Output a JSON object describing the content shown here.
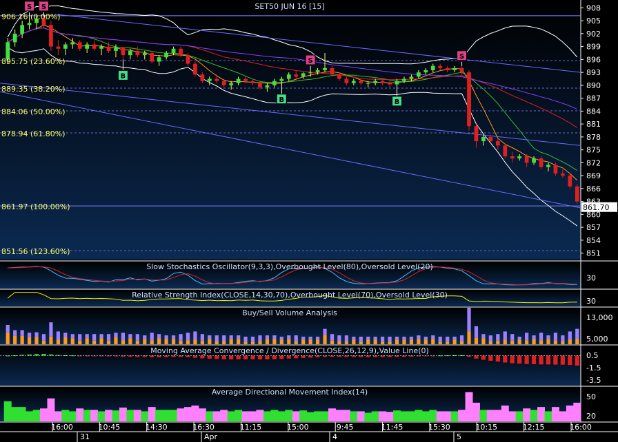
{
  "chart_data": {
    "type": "candlestick-multipanel",
    "title": "SET50 JUN 16   [15]",
    "colors": {
      "background_top": "#000000",
      "background_bottom": "#0b2a52",
      "panel_bg": "#0a2246",
      "axis_text": "#ffffff",
      "fib_text": "#ffff66",
      "title_text": "#cfe0ff",
      "candle_up": "#40e040",
      "candle_down": "#e02020",
      "bollinger": "#ffffff",
      "trendline": "#6a6aff",
      "ma_red": "#e02020",
      "ma_green": "#30c030",
      "ma_orange": "#ff9a20",
      "ma_purple": "#8040ff",
      "sell_marker": "#e0408a",
      "buy_marker": "#40e090",
      "stoch_k": "#40c0ff",
      "stoch_d": "#e02020",
      "rsi_line": "#f0f000",
      "vol_buy": "#ff9a20",
      "vol_sell": "#a080ff",
      "macd_pos": "#30e030",
      "macd_neg": "#e02020",
      "adx_plus": "#30e030",
      "adx_minus": "#ff80ff"
    },
    "price_axis": {
      "min": 849.5,
      "max": 909.5,
      "ticks": [
        908,
        905,
        902,
        899,
        896,
        893,
        890,
        887,
        884,
        881,
        878,
        875,
        872,
        869,
        866,
        863,
        860,
        857,
        854,
        851
      ],
      "last_price": "861.70"
    },
    "fib_levels": [
      {
        "label": "906.16 (0.00%)",
        "value": 906.16
      },
      {
        "label": "895.75 (23.60%)",
        "value": 895.75
      },
      {
        "label": "889.35 (38.20%)",
        "value": 889.35
      },
      {
        "label": "884.06 (50.00%)",
        "value": 884.06
      },
      {
        "label": "878.94 (61.80%)",
        "value": 878.94
      },
      {
        "label": "861.97 (100.00%)",
        "value": 861.97
      },
      {
        "label": "851.56 (123.60%)",
        "value": 851.56
      }
    ],
    "candles": [
      [
        896.0,
        901.0,
        895.0,
        900.0
      ],
      [
        900.0,
        903.0,
        899.0,
        902.0
      ],
      [
        902.0,
        905.0,
        901.0,
        904.0
      ],
      [
        904.0,
        906.0,
        903.0,
        904.5
      ],
      [
        904.5,
        906.2,
        903.0,
        905.5
      ],
      [
        905.5,
        906.0,
        903.5,
        904.0
      ],
      [
        904.0,
        905.0,
        898.0,
        899.0
      ],
      [
        899.0,
        900.5,
        897.0,
        898.5
      ],
      [
        898.5,
        900.0,
        897.0,
        899.5
      ],
      [
        899.5,
        901.0,
        898.5,
        900.0
      ],
      [
        900.0,
        900.5,
        898.0,
        898.5
      ],
      [
        898.5,
        900.0,
        897.5,
        899.5
      ],
      [
        899.5,
        900.5,
        898.0,
        898.5
      ],
      [
        898.5,
        899.5,
        897.0,
        899.0
      ],
      [
        899.0,
        900.0,
        897.5,
        898.0
      ],
      [
        898.0,
        899.5,
        896.5,
        898.8
      ],
      [
        898.8,
        899.0,
        896.0,
        897.0
      ],
      [
        897.0,
        898.5,
        896.0,
        898.0
      ],
      [
        898.0,
        899.0,
        896.5,
        897.0
      ],
      [
        897.0,
        898.0,
        896.0,
        897.5
      ],
      [
        897.5,
        898.0,
        895.0,
        895.5
      ],
      [
        895.5,
        897.0,
        894.5,
        896.5
      ],
      [
        896.5,
        898.0,
        896.0,
        897.5
      ],
      [
        897.5,
        899.0,
        897.0,
        898.5
      ],
      [
        898.5,
        899.0,
        896.5,
        897.0
      ],
      [
        897.0,
        897.5,
        894.5,
        895.0
      ],
      [
        895.0,
        895.5,
        892.0,
        892.5
      ],
      [
        892.5,
        893.0,
        890.5,
        891.0
      ],
      [
        891.0,
        892.0,
        890.0,
        891.5
      ],
      [
        891.5,
        892.5,
        890.5,
        891.0
      ],
      [
        891.0,
        891.5,
        889.5,
        890.0
      ],
      [
        890.0,
        891.0,
        889.0,
        890.5
      ],
      [
        890.5,
        892.0,
        890.0,
        891.5
      ],
      [
        891.5,
        892.0,
        890.5,
        891.0
      ],
      [
        891.0,
        891.5,
        890.0,
        890.5
      ],
      [
        890.5,
        891.0,
        889.0,
        889.5
      ],
      [
        889.5,
        890.5,
        888.5,
        890.0
      ],
      [
        890.0,
        891.5,
        889.5,
        891.0
      ],
      [
        891.0,
        892.0,
        890.5,
        891.5
      ],
      [
        891.5,
        893.0,
        891.0,
        892.5
      ],
      [
        892.5,
        893.5,
        891.5,
        892.0
      ],
      [
        892.0,
        893.0,
        891.5,
        892.8
      ],
      [
        892.8,
        893.5,
        892.0,
        893.0
      ],
      [
        893.0,
        894.0,
        892.5,
        893.5
      ],
      [
        893.5,
        897.5,
        893.0,
        894.0
      ],
      [
        894.0,
        894.5,
        892.0,
        892.5
      ],
      [
        892.5,
        893.0,
        891.0,
        891.5
      ],
      [
        891.5,
        892.0,
        890.0,
        890.5
      ],
      [
        890.5,
        891.5,
        890.0,
        891.0
      ],
      [
        891.0,
        891.5,
        890.0,
        890.5
      ],
      [
        890.5,
        891.0,
        889.5,
        890.5
      ],
      [
        890.5,
        891.5,
        890.0,
        891.0
      ],
      [
        891.0,
        891.5,
        890.0,
        890.5
      ],
      [
        890.5,
        891.0,
        889.5,
        890.2
      ],
      [
        890.2,
        891.5,
        890.0,
        891.0
      ],
      [
        891.0,
        892.0,
        890.5,
        891.5
      ],
      [
        891.5,
        892.5,
        891.0,
        892.0
      ],
      [
        892.0,
        893.5,
        891.5,
        893.0
      ],
      [
        893.0,
        894.0,
        892.5,
        893.5
      ],
      [
        893.5,
        895.0,
        893.0,
        894.5
      ],
      [
        894.5,
        895.0,
        893.5,
        894.0
      ],
      [
        894.0,
        894.5,
        893.0,
        893.5
      ],
      [
        893.5,
        894.5,
        893.0,
        894.0
      ],
      [
        894.0,
        894.5,
        892.5,
        893.0
      ],
      [
        893.0,
        893.5,
        879.5,
        880.5
      ],
      [
        880.5,
        881.0,
        875.5,
        877.0
      ],
      [
        877.0,
        878.5,
        876.0,
        878.0
      ],
      [
        878.0,
        878.5,
        876.5,
        877.0
      ],
      [
        877.0,
        877.5,
        875.0,
        876.0
      ],
      [
        876.0,
        876.5,
        873.0,
        873.5
      ],
      [
        873.5,
        874.5,
        872.0,
        873.0
      ],
      [
        873.0,
        874.0,
        872.5,
        873.5
      ],
      [
        873.5,
        874.0,
        871.0,
        872.0
      ],
      [
        872.0,
        873.5,
        871.5,
        873.0
      ],
      [
        873.0,
        873.5,
        870.5,
        871.0
      ],
      [
        871.0,
        872.0,
        870.0,
        871.5
      ],
      [
        871.5,
        872.0,
        869.0,
        869.5
      ],
      [
        869.5,
        870.5,
        868.5,
        869.0
      ],
      [
        869.0,
        869.5,
        866.0,
        866.5
      ],
      [
        866.5,
        867.0,
        862.5,
        863.0
      ]
    ],
    "signals": [
      {
        "type": "S",
        "candle": 3
      },
      {
        "type": "S",
        "candle": 5
      },
      {
        "type": "B",
        "candle": 16
      },
      {
        "type": "B",
        "candle": 38
      },
      {
        "type": "S",
        "candle": 42
      },
      {
        "type": "B",
        "candle": 54
      },
      {
        "type": "S",
        "candle": 63
      }
    ],
    "time_axis": {
      "labels": [
        "16:00",
        "10:45",
        "14:30",
        "16:30",
        "11:15",
        "15:00",
        "9:45",
        "11:45",
        "15:30",
        "10:15",
        "12:15",
        "16:00"
      ],
      "days": [
        "31",
        "Apr",
        "4",
        "5"
      ]
    },
    "panels": [
      {
        "id": "stoch",
        "title": "Slow Stochastics Oscillator(9,3,3),Overbought Level(80),Oversold Level(20)",
        "ticks": [
          "30"
        ]
      },
      {
        "id": "rsi",
        "title": "Relative Strength Index(CLOSE,14,30,70),Overbought Level(70),Oversold Level(30)",
        "ticks": [
          "30"
        ]
      },
      {
        "id": "volume",
        "title": "Buy/Sell Volume Analysis",
        "ticks": [
          "13,000",
          "5,000"
        ]
      },
      {
        "id": "macd",
        "title": "Moving Average Convergence / Divergence(CLOSE,26,12,9),Value Line(0)",
        "ticks": [
          "0.5",
          "-1.5",
          "-3.5"
        ]
      },
      {
        "id": "adx",
        "title": "Average Directional Movement Index(14)",
        "ticks": [
          "50",
          "20"
        ]
      }
    ]
  }
}
